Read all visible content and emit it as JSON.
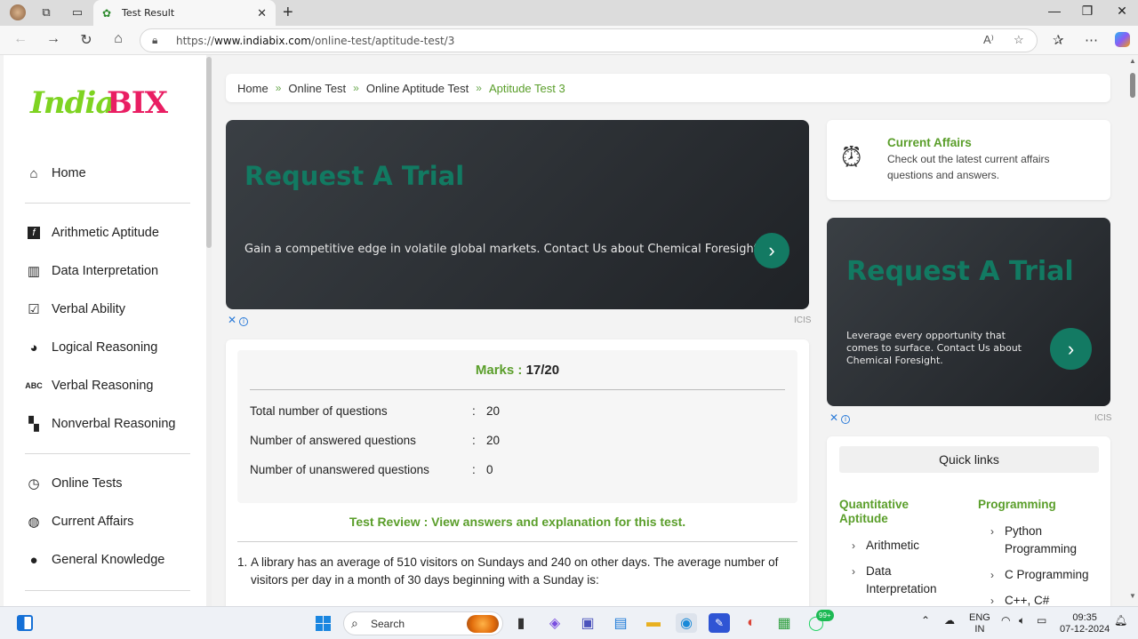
{
  "browser": {
    "tab_title": "Test Result",
    "url_prefix": "https://",
    "url_host": "www.indiabix.com",
    "url_path": "/online-test/aptitude-test/3"
  },
  "logo": {
    "part1": "India",
    "part2": "BIX"
  },
  "sidebar": {
    "items": [
      {
        "label": "Home",
        "icon": "home-icon"
      },
      {
        "label": "Arithmetic Aptitude",
        "icon": "arithmetic-icon"
      },
      {
        "label": "Data Interpretation",
        "icon": "bar-chart-icon"
      },
      {
        "label": "Verbal Ability",
        "icon": "verbal-icon"
      },
      {
        "label": "Logical Reasoning",
        "icon": "logic-icon"
      },
      {
        "label": "Verbal Reasoning",
        "icon": "abc-icon"
      },
      {
        "label": "Nonverbal Reasoning",
        "icon": "nonverbal-icon"
      },
      {
        "label": "Online Tests",
        "icon": "clock-icon"
      },
      {
        "label": "Current Affairs",
        "icon": "globe-icon"
      },
      {
        "label": "General Knowledge",
        "icon": "head-icon"
      }
    ]
  },
  "breadcrumb": {
    "items": [
      "Home",
      "Online Test",
      "Online Aptitude Test"
    ],
    "active": "Aptitude Test 3"
  },
  "ad_main": {
    "heading": "Request A Trial",
    "text": "Gain a competitive edge in volatile global markets. Contact Us about Chemical Foresight.",
    "brand": "ICIS"
  },
  "ad_side": {
    "heading": "Request A Trial",
    "text": "Leverage every opportunity that comes to surface. Contact Us about Chemical Foresight.",
    "brand": "ICIS"
  },
  "current_affairs": {
    "title": "Current Affairs",
    "desc": "Check out the latest current affairs questions and answers."
  },
  "result": {
    "marks_label": "Marks :",
    "marks_value": "17/20",
    "rows": [
      {
        "label": "Total number of questions",
        "value": "20"
      },
      {
        "label": "Number of answered questions",
        "value": "20"
      },
      {
        "label": "Number of unanswered questions",
        "value": "0"
      }
    ],
    "review": "Test Review : View answers and explanation for this test."
  },
  "question": {
    "number": "1.",
    "text": "A library has an average of 510 visitors on Sundays and 240 on other days. The average number of visitors per day in a month of 30 days beginning with a Sunday is:"
  },
  "quick_links": {
    "heading": "Quick links",
    "col1_title": "Quantitative Aptitude",
    "col1_items": [
      "Arithmetic",
      "Data Interpretation"
    ],
    "col2_title": "Programming",
    "col2_items": [
      "Python Programming",
      "C Programming",
      "C++, C#"
    ]
  },
  "taskbar": {
    "search_label": "Search",
    "badge": "99+",
    "lang1": "ENG",
    "lang2": "IN",
    "time": "09:35",
    "date": "07-12-2024"
  }
}
